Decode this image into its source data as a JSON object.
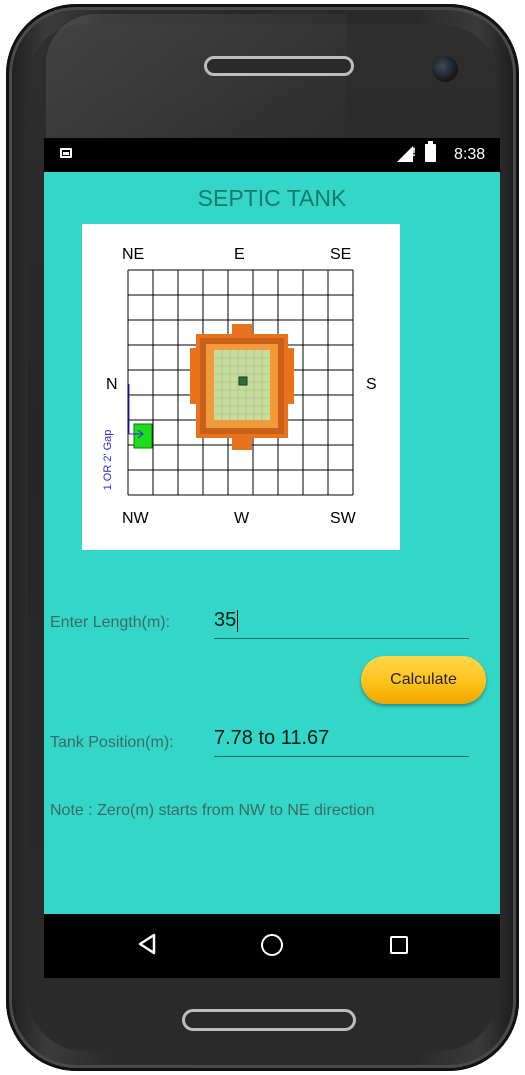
{
  "status_bar": {
    "time": "8:38",
    "signal_flag": "!"
  },
  "app": {
    "title": "SEPTIC TANK"
  },
  "diagram": {
    "directions": {
      "ne": "NE",
      "e": "E",
      "se": "SE",
      "n": "N",
      "s": "S",
      "nw": "NW",
      "w": "W",
      "sw": "SW"
    },
    "gap_label": "1 OR 2' Gap"
  },
  "length_field": {
    "label": "Enter Length(m):",
    "value": "35"
  },
  "calculate_button": {
    "label": "Calculate"
  },
  "position_field": {
    "label": "Tank Position(m):",
    "value": "7.78 to 11.67"
  },
  "note": "Note : Zero(m) starts from NW to NE direction",
  "colors": {
    "screen_bg": "#34d6c7",
    "title": "#127c6f",
    "button": "#ffc21a",
    "house": "#e8731c",
    "tank": "#1fdc1f"
  }
}
